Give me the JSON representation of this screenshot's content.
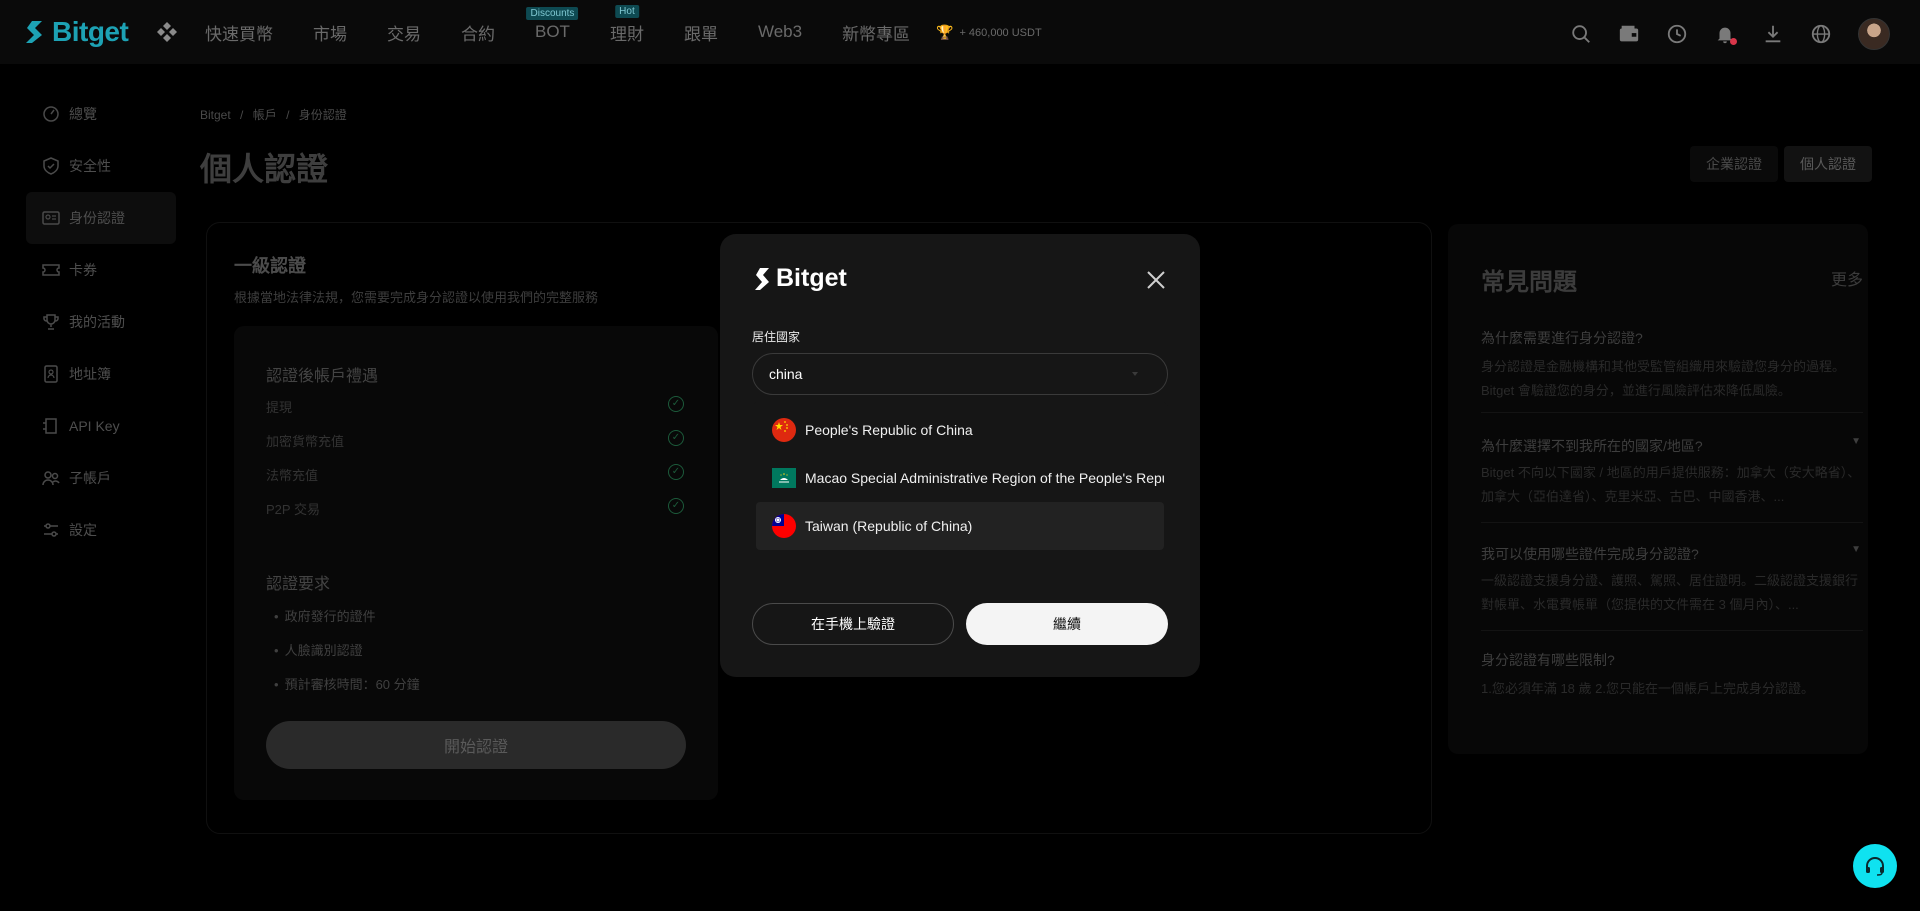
{
  "brand": {
    "name": "Bitget",
    "accent": "#1da2b4"
  },
  "nav": {
    "links": [
      {
        "label": "快速買幣",
        "badge": ""
      },
      {
        "label": "市場",
        "badge": ""
      },
      {
        "label": "交易",
        "badge": ""
      },
      {
        "label": "合約",
        "badge": ""
      },
      {
        "label": "BOT",
        "badge": "Discounts"
      },
      {
        "label": "理財",
        "badge": "Hot"
      },
      {
        "label": "跟單",
        "badge": ""
      },
      {
        "label": "Web3",
        "badge": ""
      },
      {
        "label": "新幣專區",
        "badge": ""
      }
    ],
    "promo": "+ 460,000 USDT",
    "tools": [
      "search-icon",
      "wallet-icon",
      "order-history-icon",
      "bell-icon",
      "download-icon",
      "globe-icon",
      "user-avatar"
    ]
  },
  "sidebar": {
    "items": [
      {
        "label": "總覽",
        "icon": "dashboard-icon"
      },
      {
        "label": "安全性",
        "icon": "shield-icon"
      },
      {
        "label": "身份認證",
        "icon": "id-card-icon",
        "active": true
      },
      {
        "label": "卡券",
        "icon": "ticket-icon"
      },
      {
        "label": "我的活動",
        "icon": "trophy-icon"
      },
      {
        "label": "地址簿",
        "icon": "address-book-icon"
      },
      {
        "label": "API Key",
        "icon": "api-key-icon"
      },
      {
        "label": "子帳戶",
        "icon": "sub-account-icon"
      },
      {
        "label": "設定",
        "icon": "settings-icon"
      }
    ]
  },
  "breadcrumb": [
    "Bitget",
    "/",
    "帳戶",
    "/",
    "身份認證"
  ],
  "page": {
    "title": "個人認證",
    "toggle": [
      "企業認證",
      "個人認證"
    ]
  },
  "level": {
    "title": "一級認證",
    "subtitle": "根據當地法律法規，您需要完成身分認證以使用我們的完整服務",
    "perks_title": "認證後帳戶禮遇",
    "perks": [
      "提現",
      "加密貨幣充值",
      "法幣充值",
      "P2P 交易"
    ],
    "requirements_title": "認證要求",
    "requirements": [
      "政府發行的證件",
      "人臉識別認證",
      "預計審核時間：60 分鐘"
    ],
    "start_button": "開始認證"
  },
  "faq": {
    "title": "常見問題",
    "more": "更多",
    "items": [
      {
        "q": "為什麼需要進行身分認證?",
        "a": "身分認證是金融機構和其他受監管組織用來驗證您身分的過程。Bitget 會驗證您的身分，並進行風險評估來降低風險。"
      },
      {
        "q": "為什麼選擇不到我所在的國家/地區?",
        "a": "Bitget 不向以下國家 / 地區的用戶提供服務：加拿大（安大略省）、加拿大（亞伯達省）、克里米亞、古巴、中國香港、..."
      },
      {
        "q": "我可以使用哪些證件完成身分認證?",
        "a": "一級認證支援身分證、護照、駕照、居住證明。二級認證支援銀行對帳單、水電費帳單（您提供的文件需在 3 個月內）、..."
      },
      {
        "q": "身分認證有哪些限制?",
        "a": "1.您必須年滿 18 歲 2.您只能在一個帳戶上完成身分認證。"
      }
    ]
  },
  "modal": {
    "brand": "Bitget",
    "field_label": "居住國家",
    "input_value": "china",
    "options": [
      {
        "label": "People's Republic of China",
        "flag": "cn-flag-icon"
      },
      {
        "label": "Macao Special Administrative Region of the People's Republic of China",
        "flag": "mo-flag-icon"
      },
      {
        "label": "Taiwan (Republic of China)",
        "flag": "tw-flag-icon",
        "highlighted": true
      }
    ],
    "secondary_button": "在手機上驗證",
    "primary_button": "繼續"
  }
}
